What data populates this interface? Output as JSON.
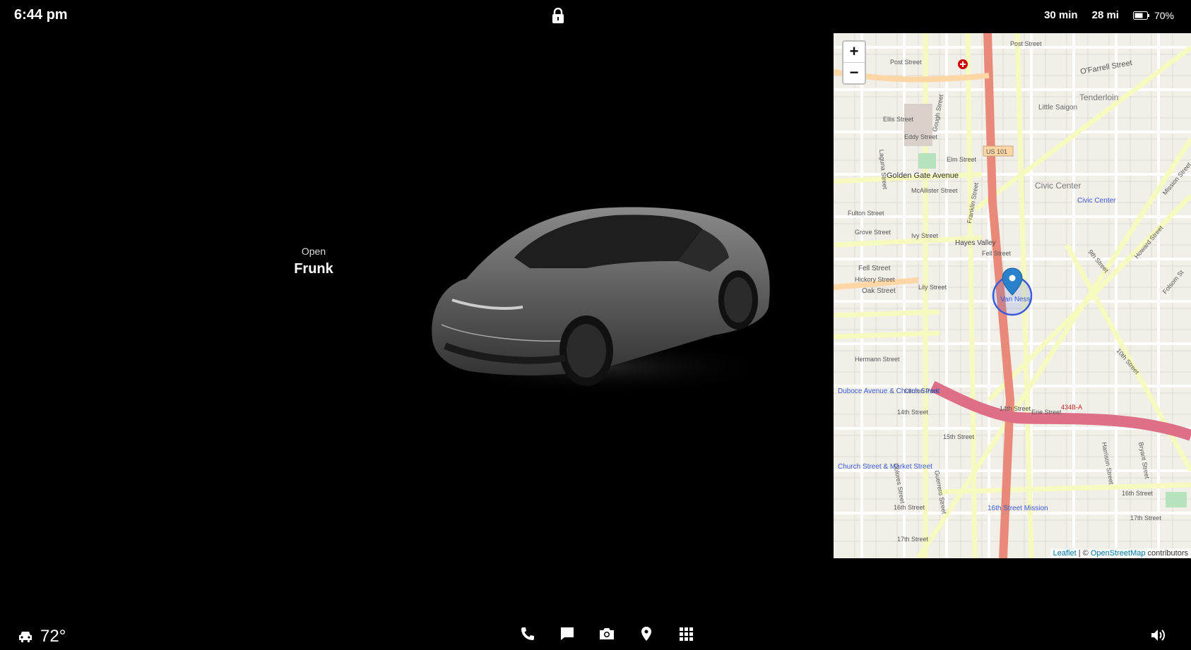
{
  "status": {
    "time": "6:44 pm",
    "duration": "30 min",
    "distance": "28 mi",
    "battery": "70%"
  },
  "frunk": {
    "action": "Open",
    "label": "Frunk"
  },
  "map": {
    "attribution_leaflet": "Leaflet",
    "attribution_sep": " | © ",
    "attribution_osm": "OpenStreetMap",
    "attribution_tail": " contributors",
    "labels": {
      "l1": "Post Street",
      "l2": "O'Farrell Street",
      "l3": "Tenderloin",
      "l4": "Little Saigon",
      "l5": "Ellis Street",
      "l6": "Eddy Street",
      "l7": "US 101",
      "l8": "Elm Street",
      "l9": "Golden Gate Avenue",
      "l10": "McAllister Street",
      "l11": "Civic Center",
      "l12": "Civic Center",
      "l13": "Fulton Street",
      "l14": "Grove Street",
      "l15": "Ivy Street",
      "l16": "Hayes Valley",
      "l17": "Fell Street",
      "l18": "Fell Street",
      "l19": "Hickory Street",
      "l20": "Oak Street",
      "l21": "Lily Street",
      "l22": "Van Ness",
      "l23": "Hermann Street",
      "l24": "Clinton Park",
      "l25": "Duboce Avenue & Church Street",
      "l26": "14th Street",
      "l27": "Church Street & Market Street",
      "l28": "15th Street",
      "l29": "16th Street",
      "l30": "16th Street Mission",
      "l31": "17th Street",
      "l32": "Erie Street",
      "l33": "434B-A",
      "l34": "10th Street",
      "l35": "Howard Street",
      "l36": "Mission Street",
      "l37": "Folsom St",
      "l38": "Harrison Street",
      "l39": "Bryant Street",
      "l40": "9th Street",
      "l41": "Gough Street",
      "l42": "Franklin Street",
      "l43": "Laguna Street",
      "l44": "Guerrero Street",
      "l45": "Dolores Street"
    },
    "zoom_in": "+",
    "zoom_out": "−"
  },
  "climate": {
    "temperature": "72°"
  },
  "icons": {
    "lock": "lock-icon",
    "battery": "battery-icon",
    "car": "car-icon",
    "phone": "phone-icon",
    "messages": "message-icon",
    "camera": "camera-icon",
    "navigation": "location-pin-icon",
    "apps": "grid-icon",
    "volume": "volume-icon"
  }
}
